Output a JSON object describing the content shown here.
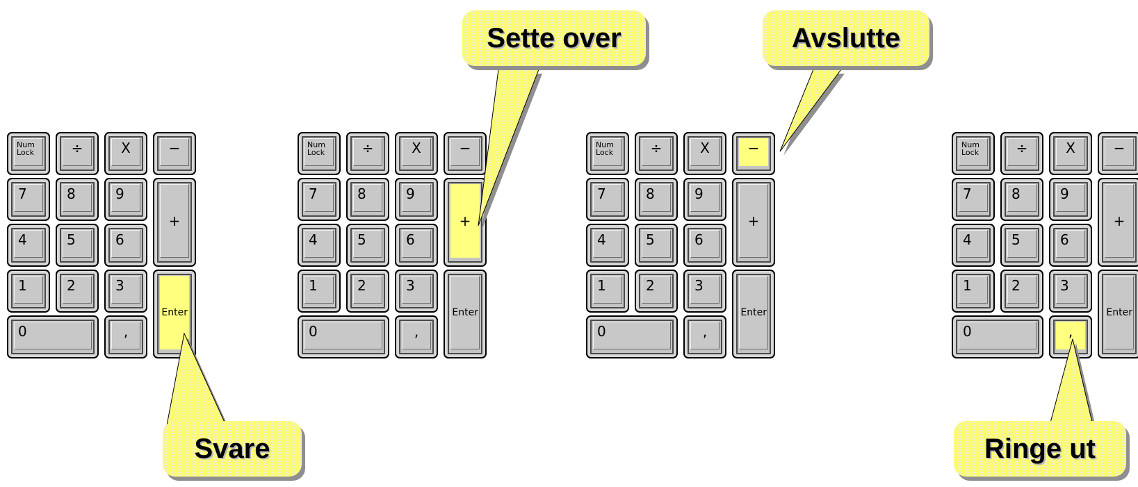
{
  "keypad": {
    "numlock_line1": "Num",
    "numlock_line2": "Lock",
    "divide": "÷",
    "multiply": "X",
    "minus": "−",
    "plus": "+",
    "enter": "Enter",
    "k7": "7",
    "k8": "8",
    "k9": "9",
    "k4": "4",
    "k5": "5",
    "k6": "6",
    "k1": "1",
    "k2": "2",
    "k3": "3",
    "k0": "0",
    "comma": ","
  },
  "highlight_color": "#ffff80",
  "callout_color": "#fbfb6e",
  "callouts": {
    "answer": "Svare",
    "transfer": "Sette over",
    "end": "Avslutte",
    "dial": "Ringe ut"
  },
  "highlighted_keys": {
    "pad_1": "enter",
    "pad_2": "plus",
    "pad_3": "minus",
    "pad_4": "comma"
  }
}
